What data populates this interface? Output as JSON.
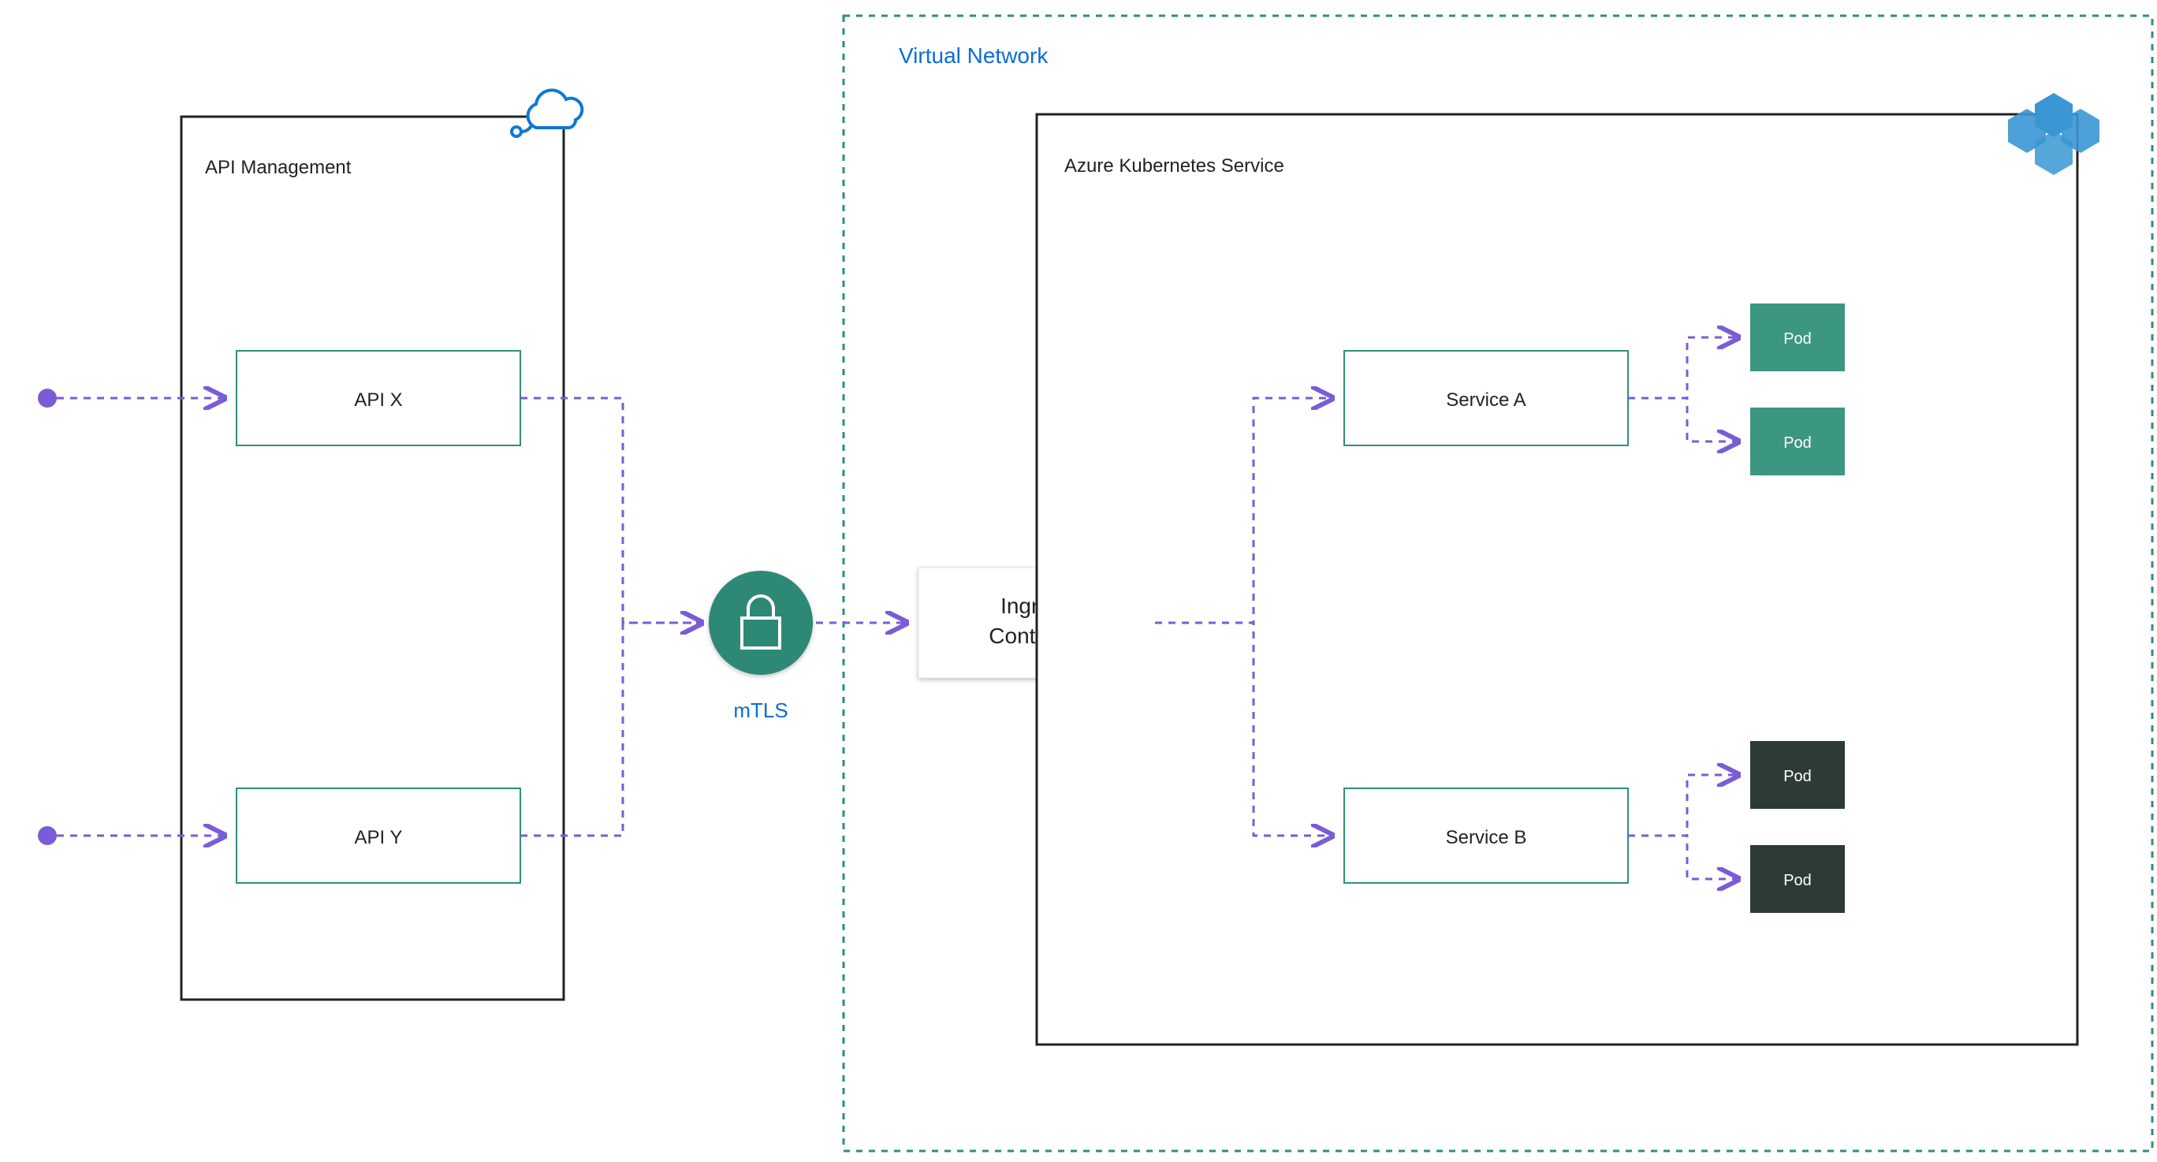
{
  "apim": {
    "title": "API Management",
    "apiX": "API X",
    "apiY": "API Y"
  },
  "mtls": "mTLS",
  "vnet": "Virtual Network",
  "aks": {
    "title": "Azure Kubernetes Service",
    "ingress_l1": "Ingress",
    "ingress_l2": "Controller",
    "serviceA": "Service A",
    "serviceB": "Service B",
    "pod": "Pod"
  },
  "colors": {
    "teal": "#2e8f7a",
    "purple": "#7a5cd6",
    "blue": "#0a6cd6",
    "podTeal": "#3b9682",
    "podDark": "#2c3a38"
  },
  "connections": [
    "external -> API X",
    "external -> API Y",
    "API X -> mTLS",
    "API Y -> mTLS",
    "mTLS -> Ingress Controller",
    "Ingress Controller -> Service A",
    "Ingress Controller -> Service B",
    "Service A -> Pod (x2)",
    "Service B -> Pod (x2)"
  ]
}
